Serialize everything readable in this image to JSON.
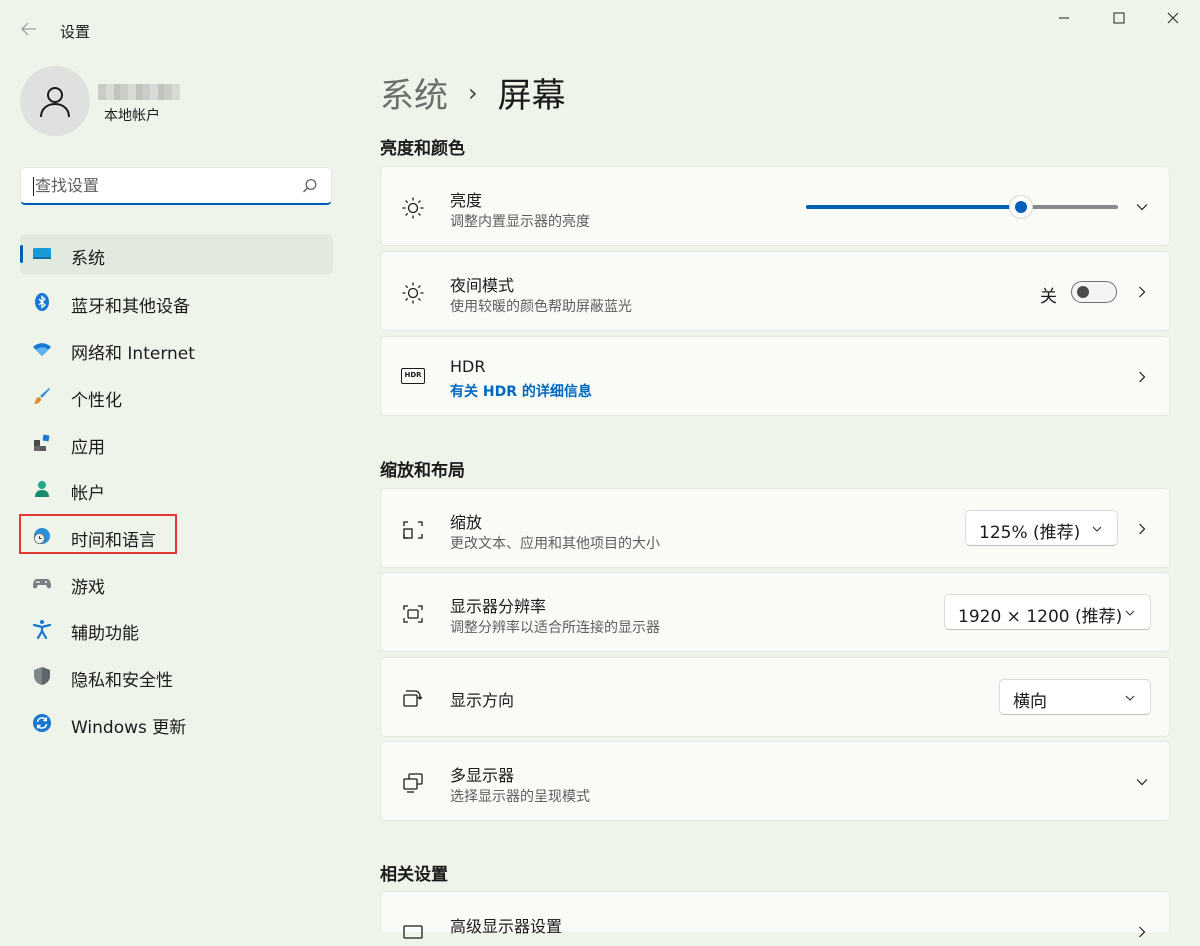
{
  "window": {
    "title": "设置",
    "back_icon": "back-arrow-icon",
    "controls": [
      "minimize-icon",
      "maximize-icon",
      "close-icon"
    ]
  },
  "profile": {
    "account_type": "本地帐户"
  },
  "search": {
    "placeholder": "查找设置"
  },
  "sidebar": {
    "items": [
      {
        "label": "系统",
        "icon": "display-icon",
        "selected": true
      },
      {
        "label": "蓝牙和其他设备",
        "icon": "bluetooth-icon"
      },
      {
        "label": "网络和 Internet",
        "icon": "wifi-icon"
      },
      {
        "label": "个性化",
        "icon": "brush-icon"
      },
      {
        "label": "应用",
        "icon": "apps-icon"
      },
      {
        "label": "帐户",
        "icon": "account-icon"
      },
      {
        "label": "时间和语言",
        "icon": "globe-clock-icon",
        "highlighted": true
      },
      {
        "label": "游戏",
        "icon": "gamepad-icon"
      },
      {
        "label": "辅助功能",
        "icon": "accessibility-icon"
      },
      {
        "label": "隐私和安全性",
        "icon": "shield-icon"
      },
      {
        "label": "Windows 更新",
        "icon": "sync-icon"
      }
    ]
  },
  "breadcrumb": {
    "parent": "系统",
    "separator": "›",
    "current": "屏幕"
  },
  "sections": {
    "brightness_color": "亮度和颜色",
    "scale_layout": "缩放和布局",
    "related": "相关设置"
  },
  "brightness": {
    "title": "亮度",
    "subtitle": "调整内置显示器的亮度",
    "value_percent": 69
  },
  "night_light": {
    "title": "夜间模式",
    "subtitle": "使用较暖的颜色帮助屏蔽蓝光",
    "state": "关"
  },
  "hdr": {
    "icon_text": "HDR",
    "title": "HDR",
    "link": "有关 HDR 的详细信息"
  },
  "scale": {
    "title": "缩放",
    "subtitle": "更改文本、应用和其他项目的大小",
    "value": "125% (推荐)"
  },
  "resolution": {
    "title": "显示器分辨率",
    "subtitle": "调整分辨率以适合所连接的显示器",
    "value": "1920 × 1200 (推荐)"
  },
  "orientation": {
    "title": "显示方向",
    "value": "横向"
  },
  "multi_display": {
    "title": "多显示器",
    "subtitle": "选择显示器的呈现模式"
  },
  "advanced_display": {
    "title": "高级显示器设置"
  },
  "colors": {
    "accent": "#005fb8",
    "background": "#eef4ea",
    "card": "#f9fbf7",
    "highlight_box": "#e53935",
    "link": "#0067c0"
  }
}
